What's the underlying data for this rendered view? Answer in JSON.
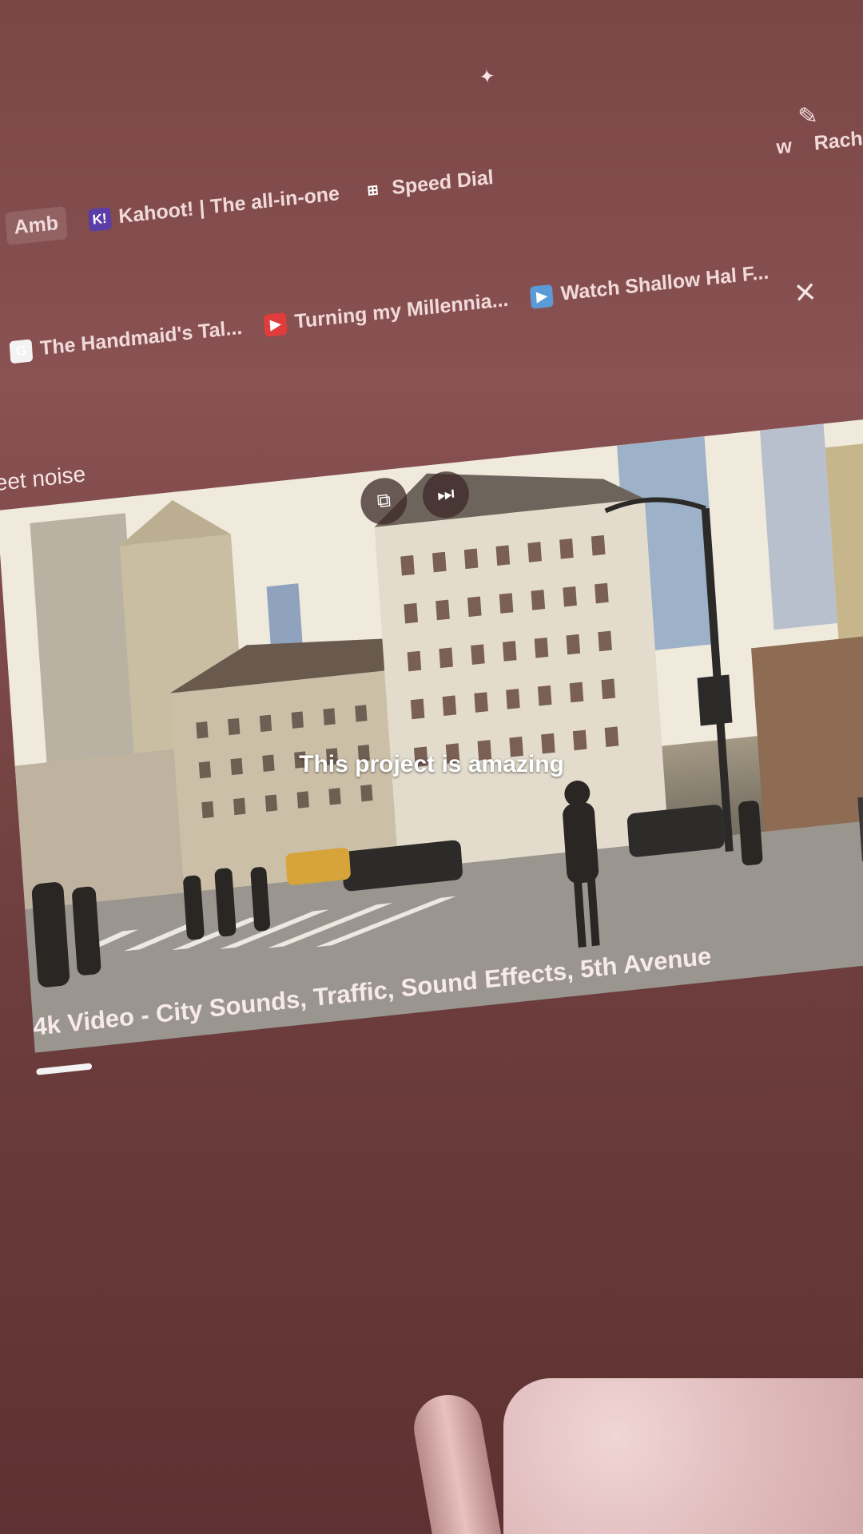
{
  "bookmarks_row1": [
    {
      "label": "Amb",
      "icon": "tab-label-fragment"
    },
    {
      "label": "Kahoot! | The all-in-one",
      "icon": "kahoot-icon"
    },
    {
      "label": "Speed Dial",
      "icon": "speed-dial-icon"
    }
  ],
  "bookmarks_row1_trailing": [
    "w",
    "Rachel M"
  ],
  "bookmarks_row2": [
    {
      "label": "The Handmaid's Tal...",
      "icon": "google-icon"
    },
    {
      "label": "Turning my Millennia...",
      "icon": "youtube-icon"
    },
    {
      "label": "Watch Shallow Hal F...",
      "icon": "play-icon"
    }
  ],
  "tab_title": "eet noise",
  "overlay_text": "This project is amazing",
  "video_caption": "4k Video - City Sounds, Traffic, Sound Effects, 5th Avenue",
  "video_progress": 0.05,
  "icons": {
    "close": "×",
    "search": "⚲",
    "sparkle": "✦",
    "edit": "✎",
    "pip": "⧉",
    "next": "⏭"
  },
  "colors": {
    "wall": "#7a4646",
    "text": "#f1dada"
  }
}
